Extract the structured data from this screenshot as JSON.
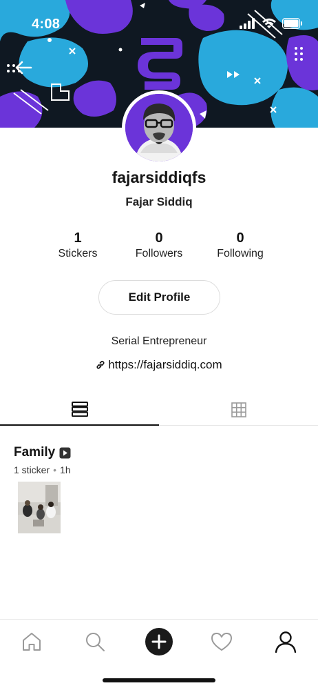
{
  "status_bar": {
    "time": "4:08",
    "icons": [
      "cellular-signal-icon",
      "wifi-icon",
      "battery-icon"
    ]
  },
  "header": {
    "back_icon": "arrow-left-icon"
  },
  "profile": {
    "username": "fajarsiddiqfs",
    "display_name": "Fajar Siddiq",
    "bio": "Serial Entrepreneur",
    "website": "https://fajarsiddiq.com"
  },
  "stats": [
    {
      "value": "1",
      "label": "Stickers"
    },
    {
      "value": "0",
      "label": "Followers"
    },
    {
      "value": "0",
      "label": "Following"
    }
  ],
  "edit_profile_label": "Edit Profile",
  "tabs": [
    {
      "name": "list-view",
      "icon": "list-icon",
      "active": true
    },
    {
      "name": "grid-view",
      "icon": "grid-icon",
      "active": false
    }
  ],
  "packs": [
    {
      "title": "Family",
      "count": "1 sticker",
      "separator": "•",
      "age": "1h"
    }
  ],
  "bottom_nav": [
    {
      "name": "home",
      "icon": "home-icon"
    },
    {
      "name": "search",
      "icon": "search-icon"
    },
    {
      "name": "create",
      "icon": "plus-circle-icon"
    },
    {
      "name": "activity",
      "icon": "heart-icon"
    },
    {
      "name": "profile",
      "icon": "person-icon"
    }
  ],
  "colors": {
    "accent_purple": "#6b34d9",
    "banner_blue": "#29a9dc",
    "banner_dark": "#0f1822",
    "text_primary": "#151515",
    "divider": "#e6e6e6"
  }
}
